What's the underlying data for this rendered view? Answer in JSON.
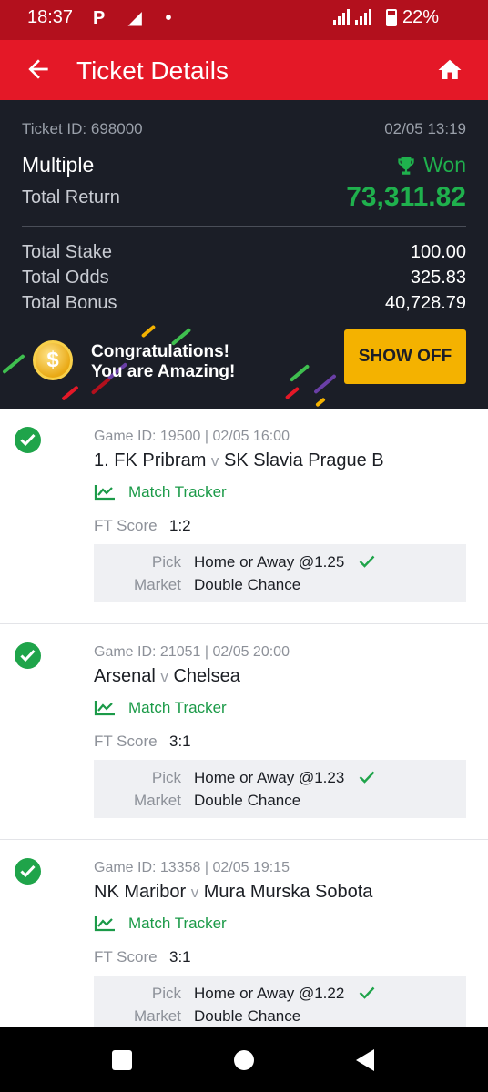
{
  "status_bar": {
    "time": "18:37",
    "icons": "P ◢ •",
    "battery": "22%"
  },
  "app_bar": {
    "title": "Ticket Details",
    "back_icon": "arrow-left-icon",
    "home_icon": "home-icon"
  },
  "ticket": {
    "id_label": "Ticket ID: 698000",
    "datetime": "02/05 13:19",
    "type": "Multiple",
    "status": "Won",
    "total_return_label": "Total Return",
    "total_return": "73,311.82",
    "total_stake_label": "Total Stake",
    "total_stake": "100.00",
    "total_odds_label": "Total Odds",
    "total_odds": "325.83",
    "total_bonus_label": "Total Bonus",
    "total_bonus": "40,728.79"
  },
  "congrats": {
    "line1": "Congratulations!",
    "line2": "You are Amazing!",
    "button": "SHOW OFF",
    "coin": "$"
  },
  "colors": {
    "brand_red": "#e41827",
    "status_red": "#b3101d",
    "won_green": "#1fb14d",
    "button_yellow": "#f4b200",
    "dark_panel": "#1b1e27"
  },
  "bets": [
    {
      "game": "Game ID: 19500 | 02/05 16:00",
      "home": "1. FK Pribram",
      "vs": "v",
      "away": "SK Slavia Prague B",
      "tracker": "Match Tracker",
      "score_label": "FT Score",
      "score": "1:2",
      "pick_label": "Pick",
      "pick": "Home or Away @1.25",
      "market_label": "Market",
      "market": "Double Chance"
    },
    {
      "game": "Game ID: 21051 | 02/05 20:00",
      "home": "Arsenal",
      "vs": "v",
      "away": "Chelsea",
      "tracker": "Match Tracker",
      "score_label": "FT Score",
      "score": "3:1",
      "pick_label": "Pick",
      "pick": "Home or Away @1.23",
      "market_label": "Market",
      "market": "Double Chance"
    },
    {
      "game": "Game ID: 13358 | 02/05 19:15",
      "home": "NK Maribor",
      "vs": "v",
      "away": "Mura Murska Sobota",
      "tracker": "Match Tracker",
      "score_label": "FT Score",
      "score": "3:1",
      "pick_label": "Pick",
      "pick": "Home or Away @1.22",
      "market_label": "Market",
      "market": "Double Chance"
    }
  ]
}
